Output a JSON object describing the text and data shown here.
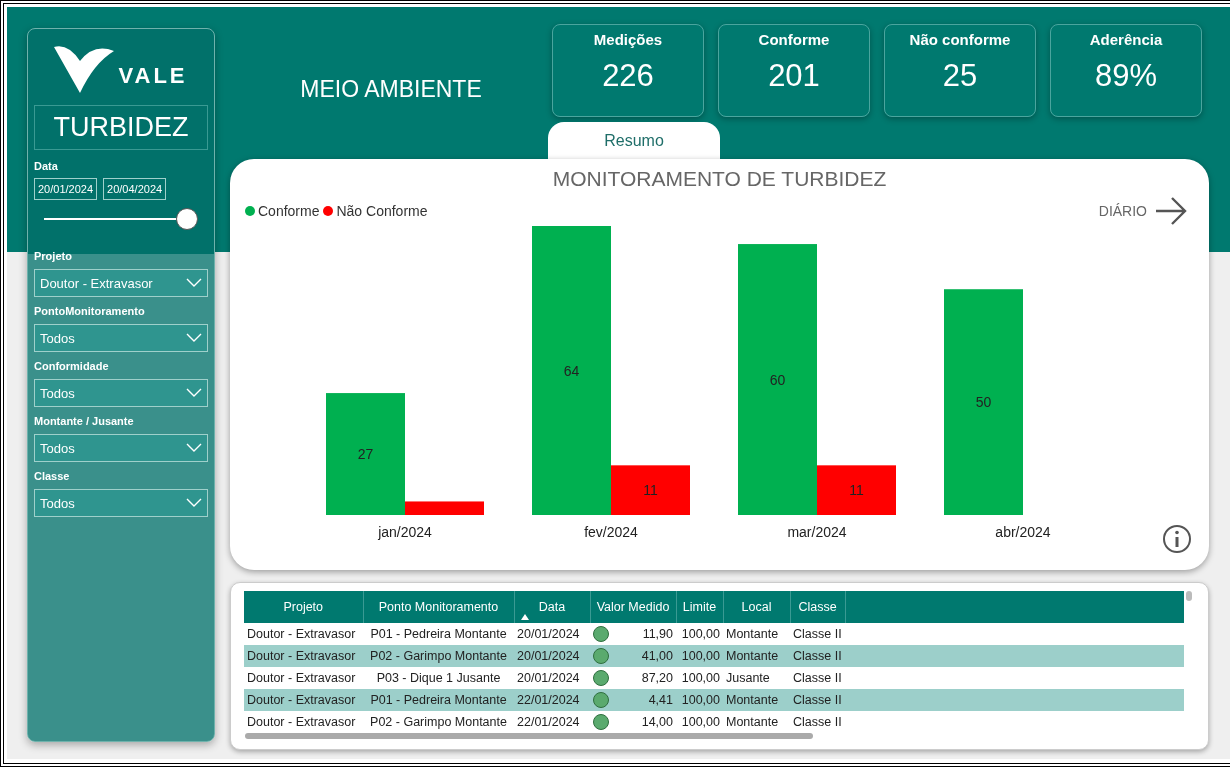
{
  "sidebar": {
    "logo_text": "VALE",
    "page_title": "TURBIDEZ",
    "date_filter": {
      "label": "Data",
      "start": "20/01/2024",
      "end": "20/04/2024",
      "level": 0.93
    },
    "filters": [
      {
        "label": "Projeto",
        "value": "Doutor - Extravasor"
      },
      {
        "label": "PontoMonitoramento",
        "value": "Todos"
      },
      {
        "label": "Conformidade",
        "value": "Todos"
      },
      {
        "label": "Montante / Jusante",
        "value": "Todos"
      },
      {
        "label": "Classe",
        "value": "Todos"
      }
    ]
  },
  "header": {
    "title": "MEIO AMBIENTE"
  },
  "kpis": [
    {
      "label": "Medições",
      "value": "226"
    },
    {
      "label": "Conforme",
      "value": "201"
    },
    {
      "label": "Não conforme",
      "value": "25"
    },
    {
      "label": "Aderência",
      "value": "89%"
    }
  ],
  "tabs": [
    {
      "label": "Resumo",
      "selected": true
    }
  ],
  "chart_card": {
    "drill_label": "DIÁRIO",
    "chart_data": {
      "type": "bar",
      "title": "MONITORAMENTO DE TURBIDEZ",
      "categories": [
        "jan/2024",
        "fev/2024",
        "mar/2024",
        "abr/2024"
      ],
      "data_labels": true,
      "series": [
        {
          "name": "Conforme",
          "color": "#00b050",
          "values": [
            27,
            64,
            60,
            50
          ],
          "value_labels": [
            "27",
            "64",
            "60",
            "50"
          ]
        },
        {
          "name": "Não Conforme",
          "color": "#ff0000",
          "values": [
            3,
            11,
            11,
            null
          ],
          "value_labels": [
            null,
            "11",
            "11",
            null
          ]
        }
      ]
    }
  },
  "table": {
    "columns": [
      {
        "label": "Projeto",
        "sorted": false
      },
      {
        "label": "Ponto Monitoramento",
        "sorted": false
      },
      {
        "label": "Data",
        "sorted": true
      },
      {
        "label": "Valor Medido",
        "sorted": false
      },
      {
        "label": "Limite",
        "sorted": false
      },
      {
        "label": "Local",
        "sorted": false
      },
      {
        "label": "Classe",
        "sorted": false
      }
    ],
    "rows": [
      {
        "projeto": "Doutor - Extravasor",
        "ponto": "P01 - Pedreira Montante",
        "data": "20/01/2024",
        "color": "#5aaa6e",
        "valor": "11,90",
        "limite": "100,00",
        "local": "Montante",
        "classe": "Classe II"
      },
      {
        "projeto": "Doutor - Extravasor",
        "ponto": "P02 - Garimpo Montante",
        "data": "20/01/2024",
        "color": "#5aaa6e",
        "valor": "41,00",
        "limite": "100,00",
        "local": "Montante",
        "classe": "Classe II"
      },
      {
        "projeto": "Doutor - Extravasor",
        "ponto": "P03 - Dique 1 Jusante",
        "data": "20/01/2024",
        "color": "#5aaa6e",
        "valor": "87,20",
        "limite": "100,00",
        "local": "Jusante",
        "classe": "Classe II"
      },
      {
        "projeto": "Doutor - Extravasor",
        "ponto": "P01 - Pedreira Montante",
        "data": "22/01/2024",
        "color": "#5aaa6e",
        "valor": "4,41",
        "limite": "100,00",
        "local": "Montante",
        "classe": "Classe II"
      },
      {
        "projeto": "Doutor - Extravasor",
        "ponto": "P02 - Garimpo Montante",
        "data": "22/01/2024",
        "color": "#5aaa6e",
        "valor": "14,00",
        "limite": "100,00",
        "local": "Montante",
        "classe": "Classe II"
      }
    ]
  }
}
